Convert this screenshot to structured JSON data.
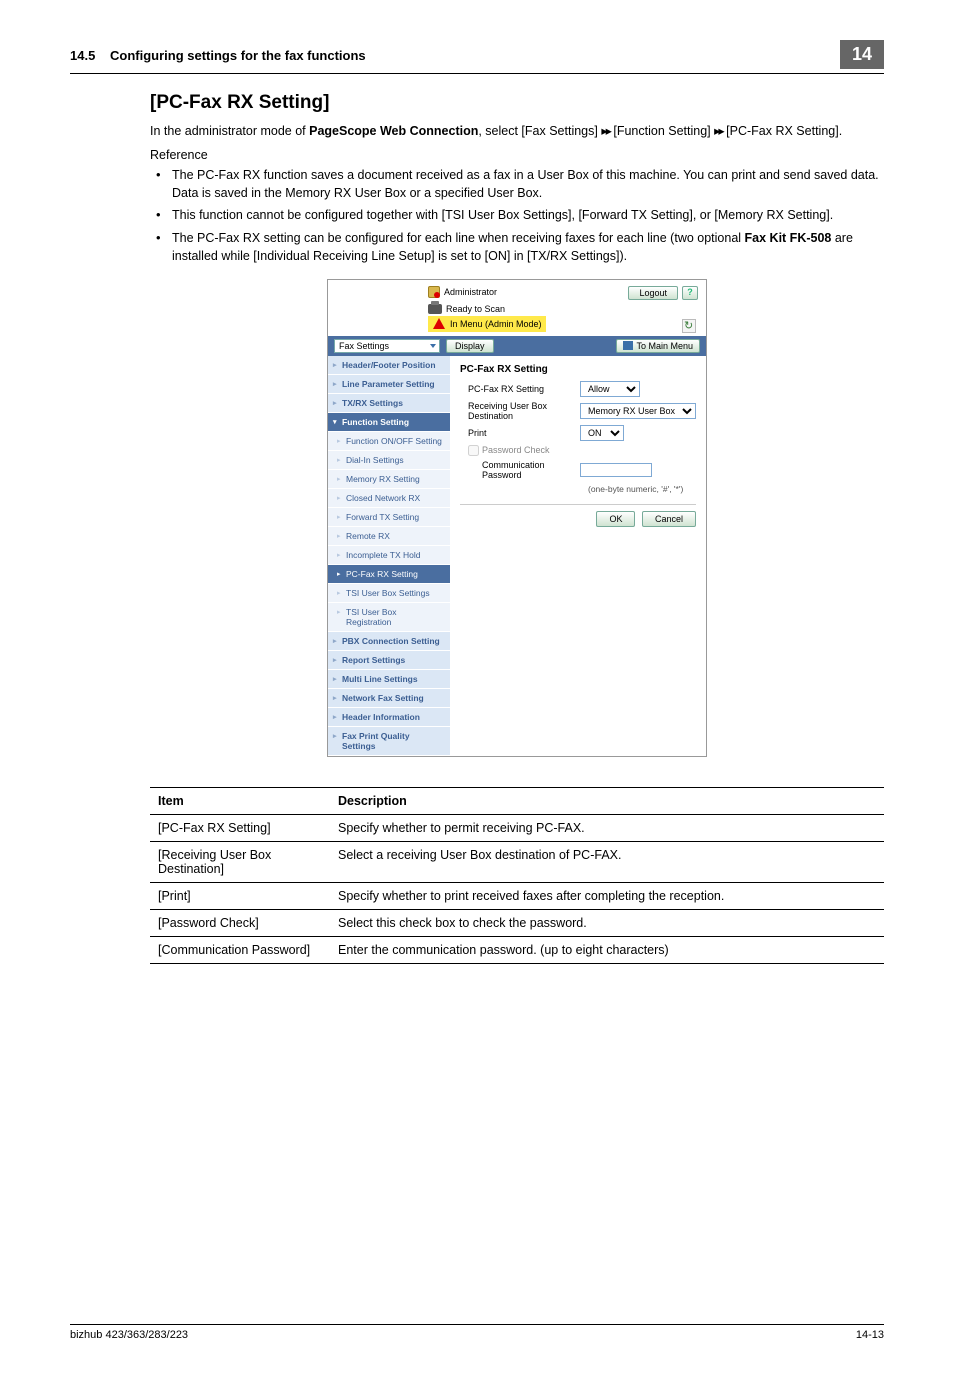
{
  "header": {
    "section_num": "14.5",
    "section_title": "Configuring settings for the fax functions",
    "chip": "14"
  },
  "title": "[PC-Fax RX Setting]",
  "intro_parts": {
    "p1": "In the administrator mode of ",
    "b1": "PageScope Web Connection",
    "p2": ", select [Fax Settings] ",
    "arr": "▸▸",
    "p3": " [Function Setting] ",
    "p4": " [PC-Fax RX Setting]."
  },
  "reference_label": "Reference",
  "bullets": [
    "The PC-Fax RX function saves a document received as a fax in a User Box of this machine. You can print and send saved data. Data is saved in the Memory RX User Box or a specified User Box.",
    "This function cannot be configured together with [TSI User Box Settings], [Forward TX Setting], or [Memory RX Setting]."
  ],
  "bullet3": {
    "p1": "The PC-Fax RX setting can be configured for each line when receiving faxes for each line (two optional ",
    "b1": "Fax Kit FK-508",
    "p2": " are installed while [Individual Receiving Line Setup] is set to [ON] in [TX/RX Settings])."
  },
  "screenshot": {
    "admin": "Administrator",
    "logout": "Logout",
    "help": "?",
    "ready": "Ready to Scan",
    "mode": "In Menu (Admin Mode)",
    "bar_select": "Fax Settings",
    "bar_display": "Display",
    "bar_tomain": "To Main Menu",
    "side_items_top": [
      "Header/Footer Position",
      "Line Parameter Setting",
      "TX/RX Settings"
    ],
    "side_dark": "Function Setting",
    "side_subs": [
      "Function ON/OFF Setting",
      "Dial-In Settings",
      "Memory RX Setting",
      "Closed Network RX",
      "Forward TX Setting",
      "Remote RX",
      "Incomplete TX Hold"
    ],
    "side_sub_active": "PC-Fax RX Setting",
    "side_subs2": [
      "TSI User Box Settings",
      "TSI User Box Registration"
    ],
    "side_items_bottom": [
      "PBX Connection Setting",
      "Report Settings",
      "Multi Line Settings",
      "Network Fax Setting",
      "Header Information",
      "Fax Print Quality Settings"
    ],
    "main_title": "PC-Fax RX Setting",
    "rows": [
      {
        "label": "PC-Fax RX Setting",
        "value": "Allow"
      },
      {
        "label": "Receiving User Box Destination",
        "value": "Memory RX User Box"
      },
      {
        "label": "Print",
        "value": "ON"
      }
    ],
    "check_label": "Password Check",
    "comm_label": "Communication Password",
    "note": "(one-byte numeric, '#', '*')",
    "ok": "OK",
    "cancel": "Cancel"
  },
  "table": {
    "head_item": "Item",
    "head_desc": "Description",
    "rows": [
      {
        "item": "[PC-Fax RX Setting]",
        "desc": "Specify whether to permit receiving PC-FAX."
      },
      {
        "item": "[Receiving User Box Destination]",
        "desc": "Select a receiving User Box destination of PC-FAX."
      },
      {
        "item": "[Print]",
        "desc": "Specify whether to print received faxes after completing the reception."
      },
      {
        "item": "[Password Check]",
        "desc": "Select this check box to check the password."
      },
      {
        "item": "[Communication Password]",
        "desc": "Enter the communication password. (up to eight characters)"
      }
    ]
  },
  "footer": {
    "left": "bizhub 423/363/283/223",
    "right": "14-13"
  }
}
